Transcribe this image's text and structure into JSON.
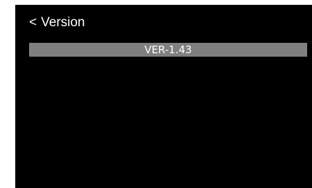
{
  "header": {
    "back_glyph": "<",
    "title": "Version",
    "icon": "back-arrow-icon"
  },
  "version": {
    "value": "VER-1.43"
  },
  "colors": {
    "screen_background": "#000000",
    "page_background": "#ffffff",
    "highlight_bar": "#808080",
    "text": "#ffffff"
  }
}
